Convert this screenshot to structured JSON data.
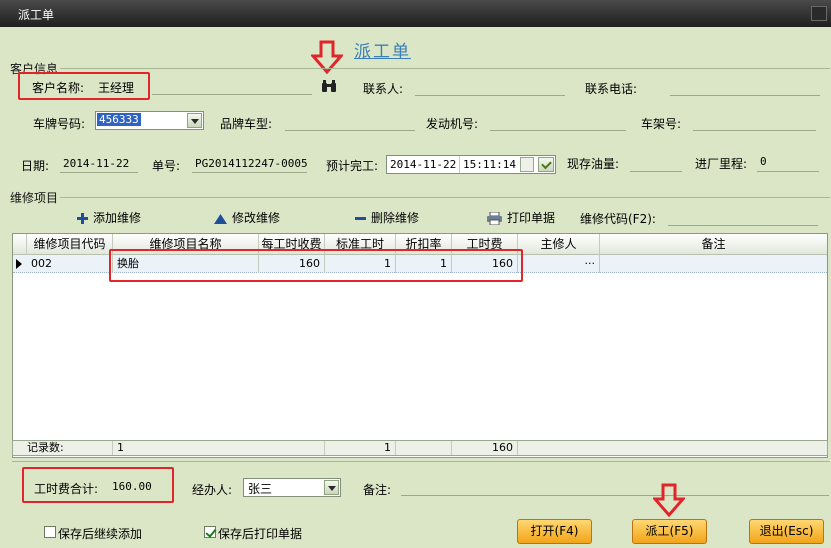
{
  "window": {
    "title": "派工单"
  },
  "header": {
    "form_title": "派工单"
  },
  "customer_info": {
    "group_label": "客户信息",
    "customer_name_label": "客户名称:",
    "customer_name_value": "王经理",
    "contact_label": "联系人:",
    "phone_label": "联系电话:",
    "plate_label": "车牌号码:",
    "plate_value": "456333",
    "brand_label": "品牌车型:",
    "engine_label": "发动机号:",
    "frame_label": "车架号:",
    "date_label": "日期:",
    "date_value": "2014-11-22",
    "order_label": "单号:",
    "order_value": "PG2014112247-0005",
    "finish_label": "预计完工:",
    "finish_date": "2014-11-22",
    "finish_time": "15:11:14",
    "fuel_label": "现存油量:",
    "mileage_label": "进厂里程:",
    "mileage_value": "0"
  },
  "repair": {
    "group_label": "维修项目",
    "toolbar": {
      "add": "添加维修",
      "edit": "修改维修",
      "delete": "删除维修",
      "print": "打印单据",
      "code_label": "维修代码(F2):"
    },
    "columns": [
      "维修项目代码",
      "维修项目名称",
      "每工时收费",
      "标准工时",
      "折扣率",
      "工时费",
      "主修人",
      "备注"
    ],
    "rows": [
      {
        "code": "002",
        "name": "换胎",
        "rate": "160",
        "hours": "1",
        "discount": "1",
        "fee": "160",
        "mechanic": "···",
        "remark": ""
      }
    ],
    "footer": {
      "label": "记录数:",
      "count": "1",
      "hours_total": "1",
      "fee_total": "160"
    }
  },
  "bottom": {
    "labor_total_label": "工时费合计:",
    "labor_total_value": "160.00",
    "handler_label": "经办人:",
    "handler_value": "张三",
    "remark_label": "备注:",
    "continue_add_label": "保存后继续添加",
    "continue_add_checked": false,
    "print_after_save_label": "保存后打印单据",
    "print_after_save_checked": true
  },
  "buttons": {
    "open": "打开(F4)",
    "dispatch": "派工(F5)",
    "exit": "退出(Esc)"
  },
  "colors": {
    "accent_red": "#e0262a",
    "button_orange": "#f2a418",
    "title_blue": "#3a7fb8"
  }
}
